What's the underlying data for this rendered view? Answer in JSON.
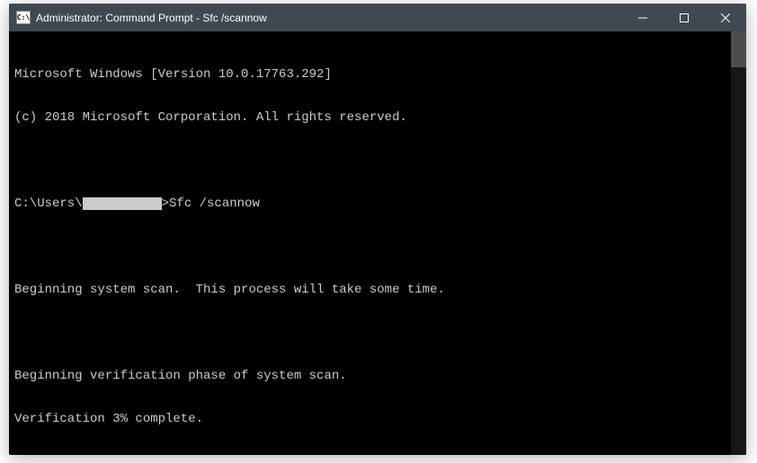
{
  "window": {
    "title": "Administrator: Command Prompt - Sfc  /scannow",
    "icon_label": "C:\\"
  },
  "terminal": {
    "line_version": "Microsoft Windows [Version 10.0.17763.292]",
    "line_copyright": "(c) 2018 Microsoft Corporation. All rights reserved.",
    "prompt_prefix": "C:\\Users\\",
    "prompt_suffix": ">Sfc /scannow",
    "line_begin_scan": "Beginning system scan.  This process will take some time.",
    "line_begin_verify": "Beginning verification phase of system scan.",
    "line_progress": "Verification 3% complete."
  }
}
